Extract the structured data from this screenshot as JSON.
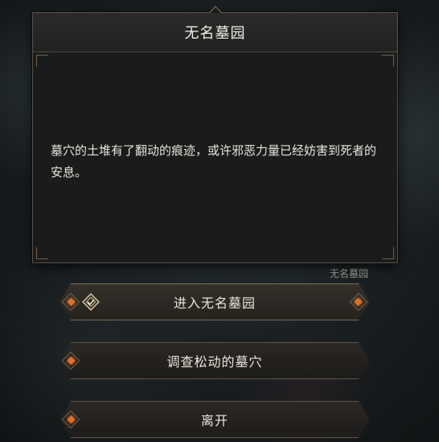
{
  "dialog": {
    "title": "无名墓园",
    "description": "墓穴的土堆有了翻动的痕迹，或许邪恶力量已经妨害到死者的安息。",
    "location_tag": "无名墓园"
  },
  "options": [
    {
      "label": "进入无名墓园",
      "selected": true,
      "icon": "selection-icon"
    },
    {
      "label": "调查松动的墓穴",
      "selected": false
    },
    {
      "label": "离开",
      "selected": false
    }
  ],
  "colors": {
    "accent": "#e0702a",
    "border": "#5a5347",
    "text": "#ece6da"
  }
}
